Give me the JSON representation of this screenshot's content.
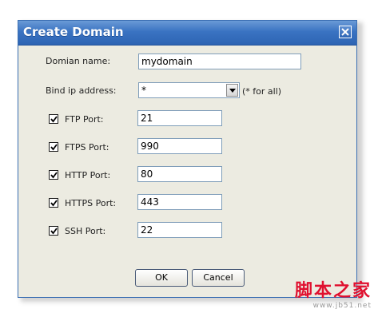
{
  "dialog": {
    "title": "Create Domain"
  },
  "form": {
    "domain_name_label": "Domian name:",
    "domain_name_value": "mydomain",
    "bind_ip_label": "Bind ip address:",
    "bind_ip_value": "*",
    "bind_ip_hint": "(* for all)",
    "ports": [
      {
        "label": "FTP Port:",
        "value": "21",
        "checked": true
      },
      {
        "label": "FTPS Port:",
        "value": "990",
        "checked": true
      },
      {
        "label": "HTTP Port:",
        "value": "80",
        "checked": true
      },
      {
        "label": "HTTPS Port:",
        "value": "443",
        "checked": true
      },
      {
        "label": "SSH Port:",
        "value": "22",
        "checked": true
      }
    ]
  },
  "buttons": {
    "ok_label": "OK",
    "cancel_label": "Cancel"
  },
  "watermark": {
    "logo": "脚本之家",
    "url": "www.jb51.net"
  },
  "colors": {
    "titlebar": "#2d64b3",
    "dialog_bg": "#ecebe1",
    "watermark": "#e0102f"
  }
}
